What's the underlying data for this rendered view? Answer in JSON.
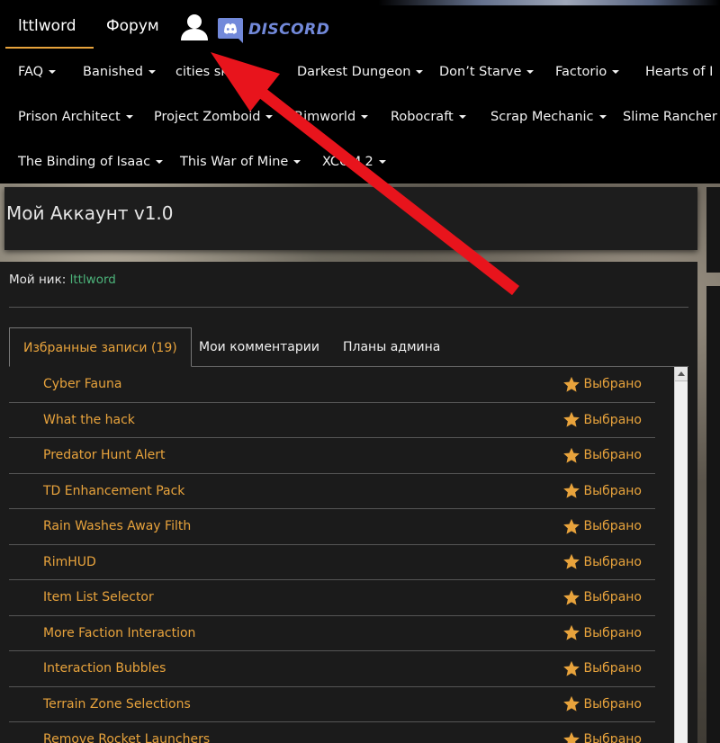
{
  "header": {
    "brand": "lttlword",
    "forum": "Форум",
    "discord_label": "DISCORD"
  },
  "nav": {
    "row1": [
      "FAQ",
      "Banished",
      "cities sk",
      "Darkest Dungeon",
      "Don’t Starve",
      "Factorio",
      "Hearts of I"
    ],
    "row2": [
      "Prison Architect",
      "Project Zomboid",
      "Rimworld",
      "Robocraft",
      "Scrap Mechanic",
      "Slime Rancher"
    ],
    "row3": [
      "The Binding of Isaac",
      "This War of Mine",
      "XCOM 2"
    ]
  },
  "account": {
    "title": "Мой Аккаунт v1.0",
    "nick_label": "Мой ник:",
    "nick_value": "lttlword"
  },
  "tabs": [
    {
      "label": "Избранные записи (19)",
      "active": true
    },
    {
      "label": "Мои комментарии",
      "active": false
    },
    {
      "label": "Планы админа",
      "active": false
    }
  ],
  "favorites": {
    "status_label": "Выбрано",
    "items": [
      "Cyber Fauna",
      "What the hack",
      "Predator Hunt Alert",
      "TD Enhancement Pack",
      "Rain Washes Away Filth",
      "RimHUD",
      "Item List Selector",
      "More Faction Interaction",
      "Interaction Bubbles",
      "Terrain Zone Selections",
      "Remove Rocket Launchers"
    ]
  },
  "colors": {
    "accent": "#e8a33c",
    "nick": "#4cb37a",
    "discord": "#7289da",
    "annotation_arrow": "#e8141c"
  },
  "icons": {
    "user": "user-icon",
    "discord": "discord-icon",
    "star": "star-icon",
    "caret": "chevron-down-icon"
  }
}
